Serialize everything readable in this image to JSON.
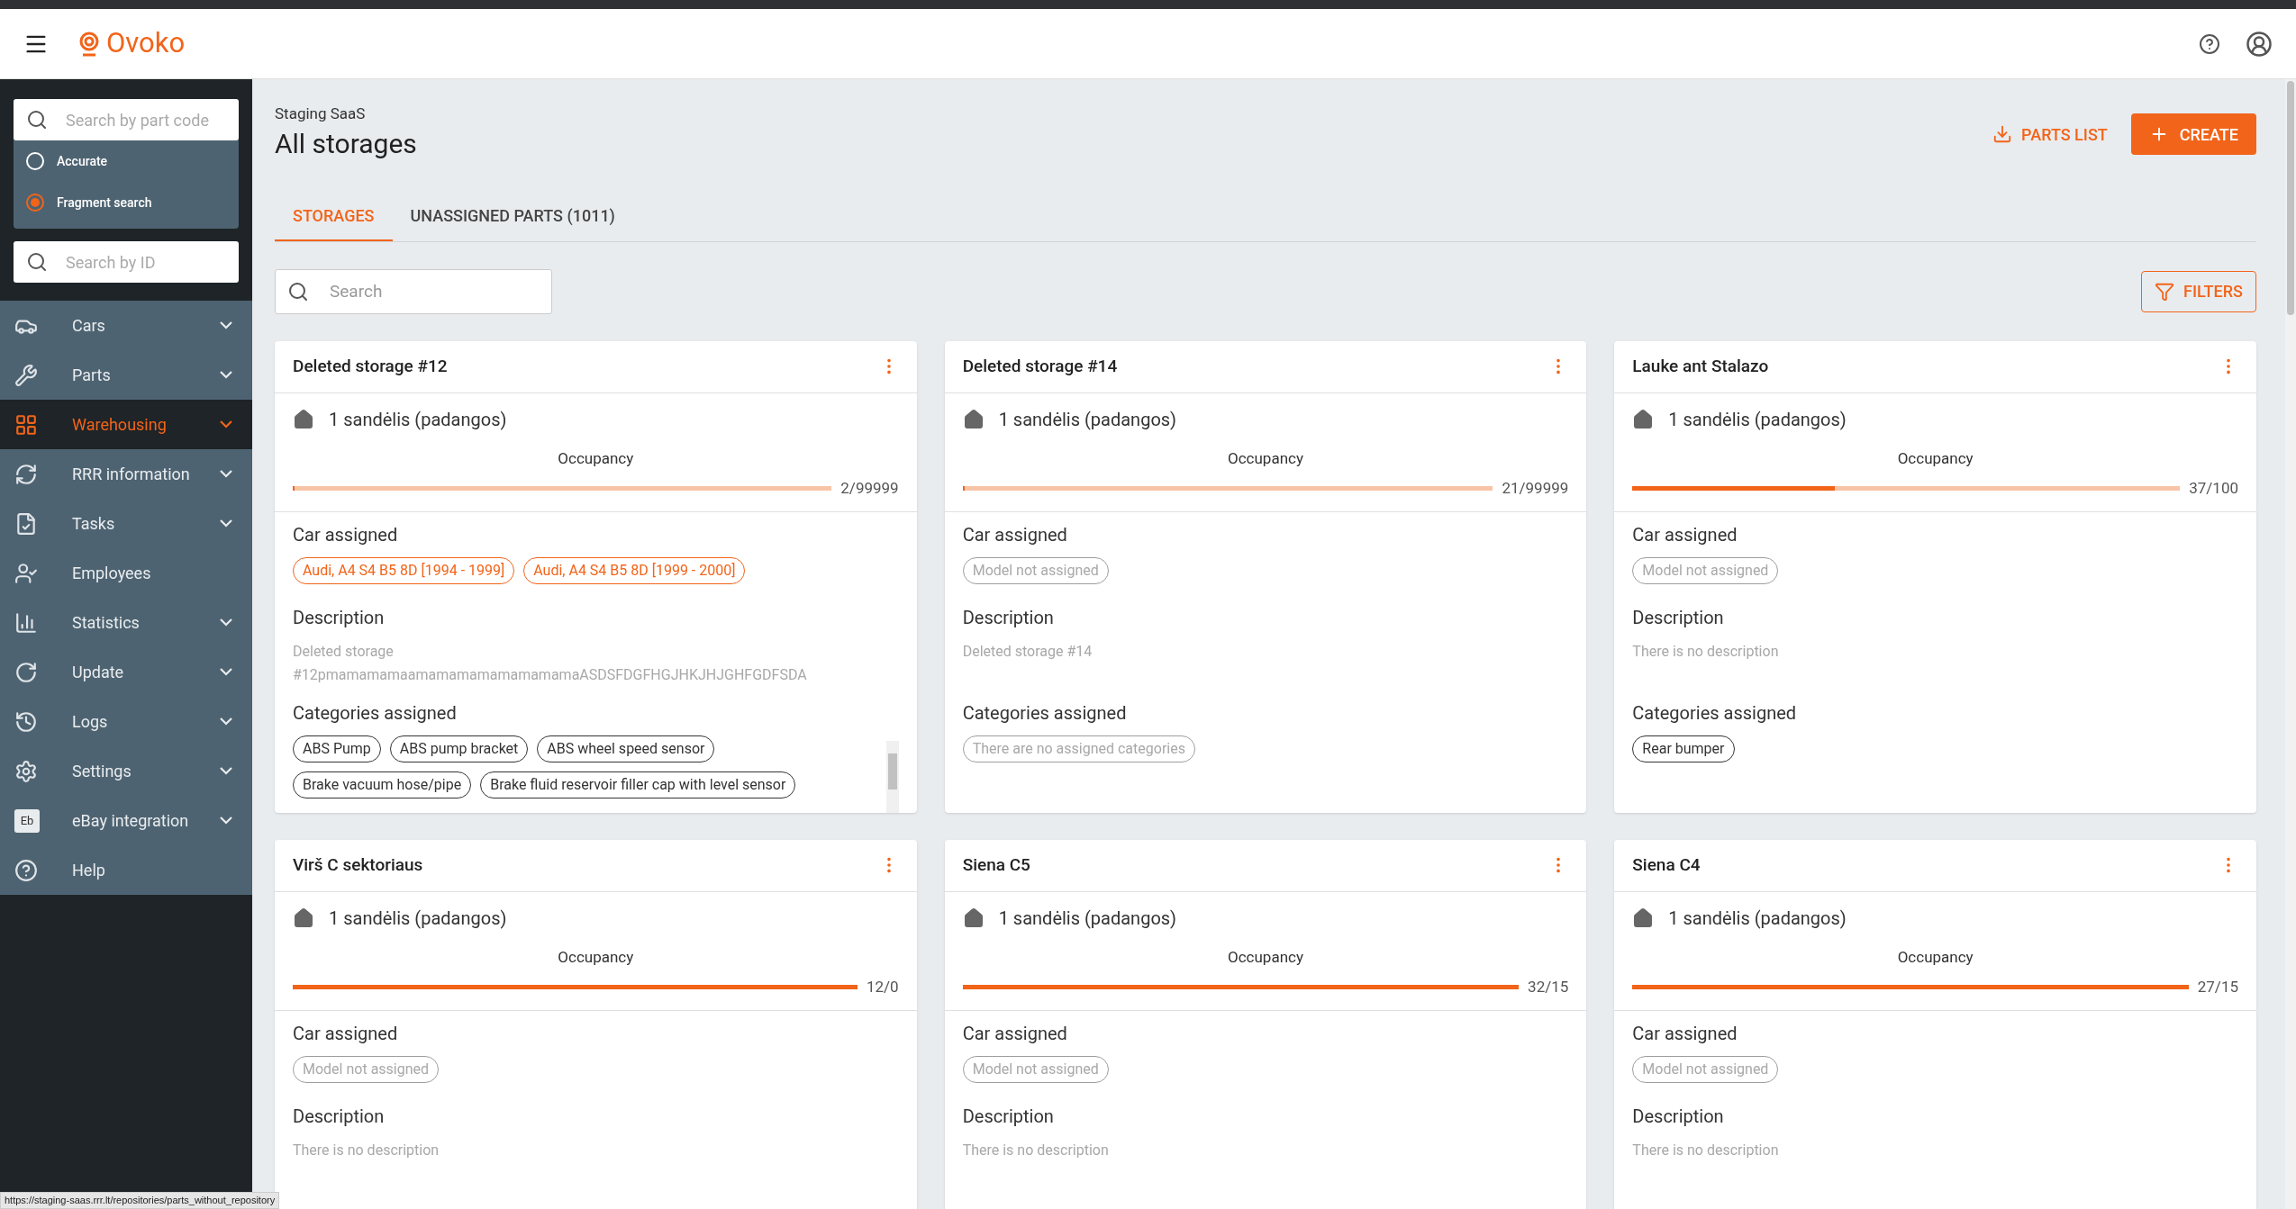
{
  "header": {
    "logo": "Ovoko"
  },
  "sidebar": {
    "part_search": {
      "placeholder": "Search by part code"
    },
    "search_modes": [
      {
        "label": "Accurate",
        "selected": false
      },
      {
        "label": "Fragment search",
        "selected": true
      }
    ],
    "id_search": {
      "placeholder": "Search by ID"
    },
    "items": [
      {
        "label": "Cars",
        "expandable": true,
        "selected": false
      },
      {
        "label": "Parts",
        "expandable": true,
        "selected": false
      },
      {
        "label": "Warehousing",
        "expandable": true,
        "selected": true
      },
      {
        "label": "RRR information",
        "expandable": true,
        "selected": false
      },
      {
        "label": "Tasks",
        "expandable": true,
        "selected": false
      },
      {
        "label": "Employees",
        "expandable": false,
        "selected": false
      },
      {
        "label": "Statistics",
        "expandable": true,
        "selected": false
      },
      {
        "label": "Update",
        "expandable": true,
        "selected": false
      },
      {
        "label": "Logs",
        "expandable": true,
        "selected": false
      },
      {
        "label": "Settings",
        "expandable": true,
        "selected": false
      },
      {
        "label": "eBay integration",
        "expandable": true,
        "selected": false,
        "badge": "Eb"
      },
      {
        "label": "Help",
        "expandable": false,
        "selected": false
      }
    ]
  },
  "page": {
    "breadcrumb": "Staging SaaS",
    "title": "All storages",
    "actions": [
      "PARTS LIST",
      "CREATE"
    ]
  },
  "tabs": [
    {
      "label": "STORAGES",
      "selected": true
    },
    {
      "label": "UNASSIGNED PARTS (1011)",
      "selected": false
    }
  ],
  "search": {
    "placeholder": "Search"
  },
  "filters_button": "FILTERS",
  "cards": [
    {
      "title": "Deleted storage #12",
      "warehouse": "1 sandėlis (padangos)",
      "occupancy_label": "Occupancy",
      "level": 0,
      "reading": "2/99999",
      "car_label": "Car assigned",
      "cars": [
        "Audi, A4 S4 B5 8D [1994 - 1999]",
        "Audi, A4 S4 B5 8D [1999 - 2000]"
      ],
      "description_label": "Description",
      "description": "Deleted storage #12pmamamamaamamamamamamamamaASDSFDGFHGJHKJHJGHFGDFSDA",
      "categories_label": "Categories assigned",
      "categories": [
        "ABS Pump",
        "ABS pump bracket",
        "ABS wheel speed sensor",
        "Brake vacuum hose/pipe",
        "Brake fluid reservoir filler cap with level sensor"
      ],
      "scrollable": true
    },
    {
      "title": "Deleted storage #14",
      "warehouse": "1 sandėlis (padangos)",
      "occupancy_label": "Occupancy",
      "level": 0,
      "reading": "21/99999",
      "car_label": "Car assigned",
      "no_car": "Model not assigned",
      "description_label": "Description",
      "description": "Deleted storage #14",
      "categories_label": "Categories assigned",
      "no_categories": "There are no assigned categories"
    },
    {
      "title": "Lauke ant Stalazo",
      "warehouse": "1 sandėlis (padangos)",
      "occupancy_label": "Occupancy",
      "level": 0.37,
      "reading": "37/100",
      "car_label": "Car assigned",
      "no_car": "Model not assigned",
      "description_label": "Description",
      "description": "There is no description",
      "categories_label": "Categories assigned",
      "categories": [
        "Rear bumper"
      ]
    },
    {
      "title": "Virš C sektoriaus",
      "warehouse": "1 sandėlis (padangos)",
      "occupancy_label": "Occupancy",
      "level": 1,
      "reading": "12/0",
      "car_label": "Car assigned",
      "no_car": "Model not assigned",
      "description_label": "Description",
      "description": "There is no description"
    },
    {
      "title": "Siena C5",
      "warehouse": "1 sandėlis (padangos)",
      "occupancy_label": "Occupancy",
      "level": 1,
      "reading": "32/15",
      "car_label": "Car assigned",
      "no_car": "Model not assigned",
      "description_label": "Description",
      "description": "There is no description"
    },
    {
      "title": "Siena C4",
      "warehouse": "1 sandėlis (padangos)",
      "occupancy_label": "Occupancy",
      "level": 1,
      "reading": "27/15",
      "car_label": "Car assigned",
      "no_car": "Model not assigned",
      "description_label": "Description",
      "description": "There is no description"
    }
  ],
  "status_url": "https://staging-saas.rrr.lt/repositories/parts_without_repository"
}
